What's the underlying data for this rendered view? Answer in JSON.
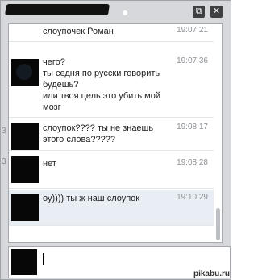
{
  "window": {
    "controls": {
      "popout_glyph": "⧉",
      "close_glyph": "✕"
    }
  },
  "left_strip": {
    "chars": [
      "3",
      "3"
    ]
  },
  "messages": [
    {
      "text": "слоупочек Роман",
      "time": "19:07:21",
      "show_avatar": false
    },
    {
      "text": "чего?\nты седня по русски говорить\nбудешь?\nили твоя цель это убить мой мозг",
      "time": "19:07:36",
      "show_avatar": true
    },
    {
      "text": "слоупок???? ты не знаешь\nэтого слова?????",
      "time": "19:08:17",
      "show_avatar": true
    },
    {
      "text": "нет",
      "time": "19:08:28",
      "show_avatar": true
    },
    {
      "text": "оу)))) ты ж наш слоупок",
      "time": "19:10:29",
      "show_avatar": true,
      "highlight": true
    }
  ],
  "input": {
    "value": ""
  },
  "watermark": "pikabu.ru"
}
